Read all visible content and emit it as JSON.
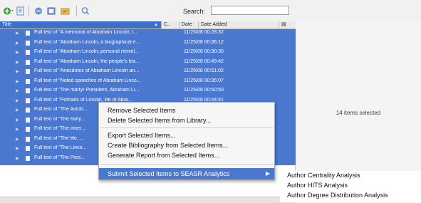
{
  "toolbar": {
    "search_label": "Search:",
    "search_value": ""
  },
  "columns": {
    "title": "Title",
    "creator": "C..",
    "date": "Date",
    "date_added": "Date Added"
  },
  "rows": [
    {
      "title": "Full text of \"A memorial of Abraham Lincoln, l...",
      "date_added": "11/25/08 00:28:32"
    },
    {
      "title": "Full text of \"Abraham Lincoln, a biographical e...",
      "date_added": "11/25/08 00:36:12"
    },
    {
      "title": "Full text of \"Abraham Lincoln, personal reminl...",
      "date_added": "11/25/08 00:30:30"
    },
    {
      "title": "Full text of \"Abraham Lincoln, the people's lea...",
      "date_added": "11/25/08 00:49:42"
    },
    {
      "title": "Full text of \"Anecdotes of Abraham Lincoln an...",
      "date_added": "11/25/08 00:51:02"
    },
    {
      "title": "Full text of \"Noted speeches of Abraham Linco...",
      "date_added": "11/25/08 00:35:07"
    },
    {
      "title": "Full text of \"The martyr President, Abraham Li...",
      "date_added": "11/25/08 00:50:50"
    },
    {
      "title": "Full text of \"Portraits of Lincoln, life of Abra...",
      "date_added": "11/25/08 00:44:41"
    },
    {
      "title": "Full text of \"The Autob...",
      "date_added": ""
    },
    {
      "title": "Full text of \"The early...",
      "date_added": ""
    },
    {
      "title": "Full text of \"The inner...",
      "date_added": ""
    },
    {
      "title": "Full text of \"The life, ...",
      "date_added": ""
    },
    {
      "title": "Full text of \"The Linco...",
      "date_added": ""
    },
    {
      "title": "Full text of \"The Pres...",
      "date_added": ""
    }
  ],
  "pane": {
    "status": "14 items selected"
  },
  "context_menu": {
    "remove": "Remove Selected Items",
    "delete": "Delete Selected Items from Library...",
    "export": "Export Selected Items...",
    "bibliography": "Create Bibliography from Selected Items...",
    "report": "Generate Report from Selected Items...",
    "submit": "Submit Selected Items to SEASR Analytics",
    "submit_arrow": "▶"
  },
  "submenu": {
    "centrality": "Author Centrality Analysis",
    "hits": "Author HITS Analysis",
    "degree": "Author Degree Distribution Analysis"
  }
}
